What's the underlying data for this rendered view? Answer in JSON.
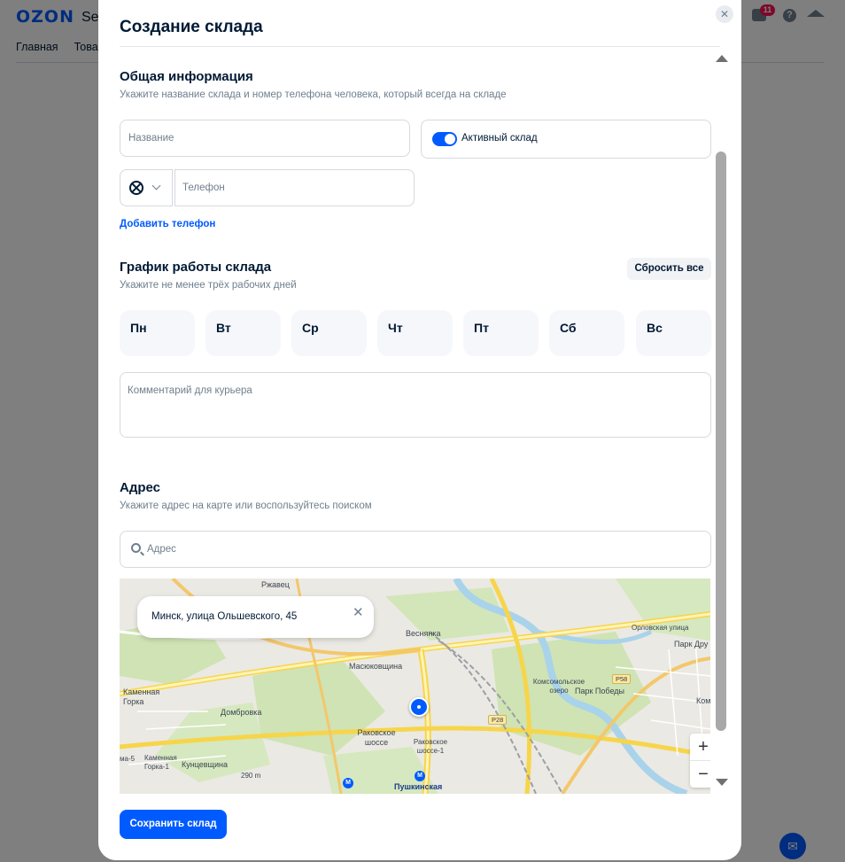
{
  "background": {
    "logo": "OZON",
    "logo_suffix": "Sel",
    "nav": [
      "Главная",
      "Товар"
    ],
    "notifications_count": "11",
    "help_glyph": "?"
  },
  "modal": {
    "title": "Создание склада",
    "general": {
      "title": "Общая информация",
      "subtitle": "Укажите название склада и номер телефона человека, который всегда на складе",
      "name_placeholder": "Название",
      "active_label": "Активный склад",
      "active": true,
      "phone_placeholder": "Телефон",
      "add_phone_link": "Добавить телефон"
    },
    "schedule": {
      "title": "График работы склада",
      "subtitle": "Укажите не менее трёх рабочих дней",
      "reset_button": "Сбросить все",
      "days": [
        "Пн",
        "Вт",
        "Ср",
        "Чт",
        "Пт",
        "Сб",
        "Вс"
      ],
      "comment_placeholder": "Комментарий для курьера"
    },
    "address": {
      "title": "Адрес",
      "subtitle": "Укажите адрес на карте или воспользуйтесь поиском",
      "search_placeholder": "Адрес",
      "popup_text": "Минск, улица Ольшевского, 45",
      "map_labels": [
        "Ржавец",
        "Веснянка",
        "Масюковщина",
        "Каменная Горка",
        "Домбровка",
        "Раковское шоссе",
        "Раковское шоссе-1",
        "Кунцевщина",
        "Каменная Горка-1",
        "Пушкинская",
        "Комсомольское озеро",
        "Парк Победы",
        "Орловская улица",
        "Парк Дру",
        "Ком",
        "290 m",
        "P28",
        "P58",
        "ма-5"
      ]
    },
    "save_button": "Сохранить склад"
  },
  "colors": {
    "accent": "#005bff",
    "text": "#001a34",
    "muted": "#707f8d"
  },
  "icons": [
    "close-icon",
    "search-icon",
    "flag-icon",
    "chevron-down-icon",
    "map-pin-icon",
    "zoom-in-icon",
    "zoom-out-icon",
    "chat-icon",
    "help-icon",
    "academy-icon"
  ]
}
